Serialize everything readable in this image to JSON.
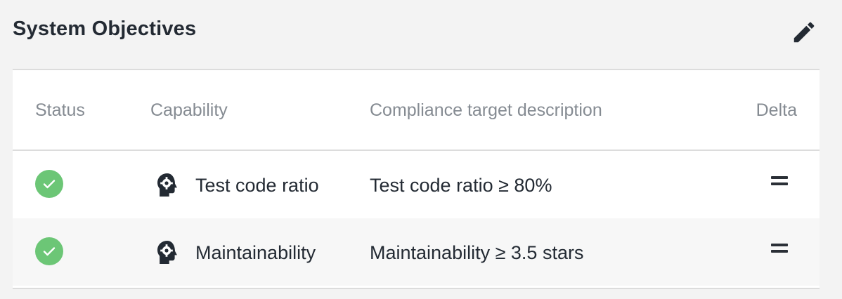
{
  "panel": {
    "title": "System Objectives",
    "edit_icon": "pencil-icon"
  },
  "table": {
    "columns": [
      "Status",
      "Capability",
      "Compliance target description",
      "Delta"
    ],
    "rows": [
      {
        "status": "passed",
        "status_icon": "check-circle-icon",
        "capability_icon": "head-gear-icon",
        "capability": "Test code ratio",
        "description": "Test code ratio ≥ 80%",
        "delta": "equal",
        "delta_icon": "equals-icon"
      },
      {
        "status": "passed",
        "status_icon": "check-circle-icon",
        "capability_icon": "head-gear-icon",
        "capability": "Maintainability",
        "description": "Maintainability ≥ 3.5 stars",
        "delta": "equal",
        "delta_icon": "equals-icon"
      }
    ]
  },
  "colors": {
    "success": "#6cc676",
    "text": "#232a33",
    "muted": "#858b92",
    "divider": "#dcdcdc",
    "background": "#f3f3f3"
  }
}
